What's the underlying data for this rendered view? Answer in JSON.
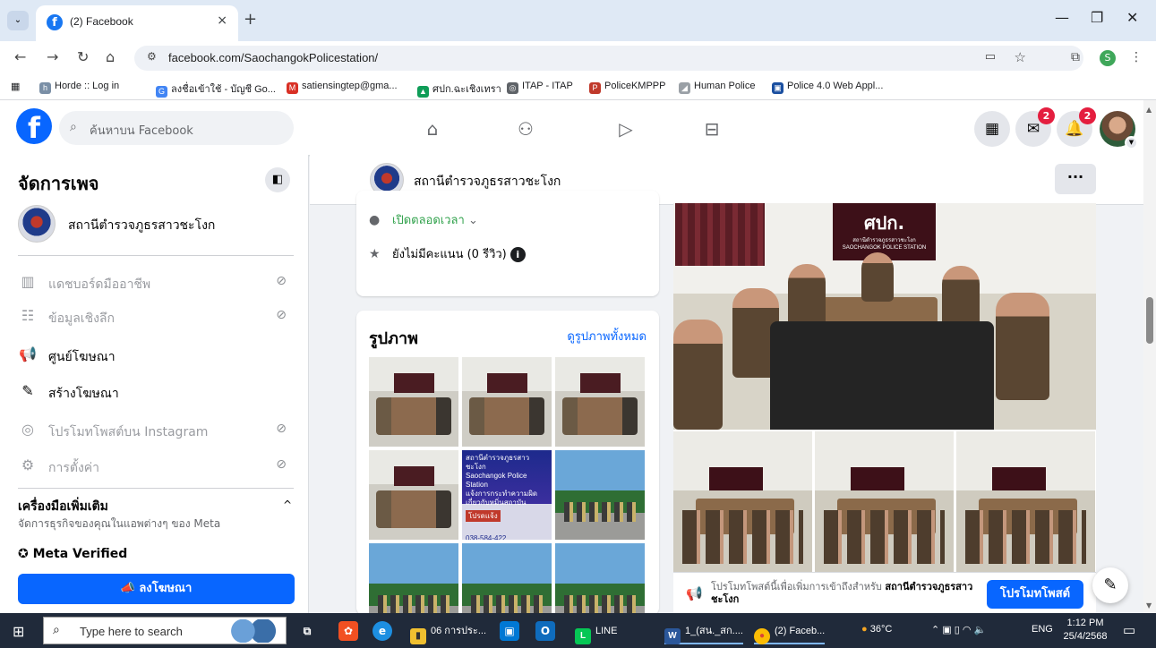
{
  "browser": {
    "tab_title": "(2) Facebook",
    "tab_close": "×",
    "new_tab": "+",
    "url": "facebook.com/SaochangokPolicestation/",
    "bookmarks": [
      "Horde :: Log in",
      "ลงชื่อเข้าใช้ - บัญชี Go...",
      "satiensingtep@gma...",
      "ศปก.ฉะเชิงเทรา",
      "ITAP - ITAP",
      "PoliceKMPPP",
      "Human Police",
      "Police 4.0 Web Appl..."
    ],
    "profile_letter": "S"
  },
  "fb": {
    "search_placeholder": "ค้นหาบน Facebook",
    "messenger_badge": "2",
    "notifications_badge": "2"
  },
  "sidebar": {
    "title": "จัดการเพจ",
    "page_name": "สถานีตำรวจภูธรสาวชะโงก",
    "items": [
      {
        "label": "แดชบอร์ดมืออาชีพ",
        "icon": "chart-icon",
        "disabled": true
      },
      {
        "label": "ข้อมูลเชิงลึก",
        "icon": "insights-icon",
        "disabled": true
      },
      {
        "label": "ศูนย์โฆษณา",
        "icon": "megaphone-icon",
        "disabled": false
      },
      {
        "label": "สร้างโฆษณา",
        "icon": "pencil-icon",
        "disabled": false
      },
      {
        "label": "โปรโมทโพสต์บน Instagram",
        "icon": "instagram-icon",
        "disabled": true
      },
      {
        "label": "การตั้งค่า",
        "icon": "gear-icon",
        "disabled": true
      }
    ],
    "more_tools_title": "เครื่องมือเพิ่มเติม",
    "more_tools_sub": "จัดการธุรกิจของคุณในแอพต่างๆ ของ Meta",
    "meta_verified": "Meta Verified",
    "ad_button": "ลงโฆษณา"
  },
  "page": {
    "name": "สถานีตำรวจภูธรสาวชะโงก",
    "more": "···",
    "hours": "เปิดตลอดเวลา",
    "rating": "ยังไม่มีคะแนน (0 รีวิว)"
  },
  "photos": {
    "title": "รูปภาพ",
    "see_all": "ดูรูปภาพทั้งหมด",
    "poster_lines": [
      "สถานีตำรวจภูธรสาวชะโงก",
      "Saochangok Police Station",
      "แจ้งการกระทำความผิด",
      "เกี่ยวกับหมิ่นสถาบัน",
      "โปรดแจ้ง"
    ],
    "poster_phone": "038-584-422"
  },
  "post": {
    "sign_text": "ศปก.",
    "sign_sub1": "สถานีตำรวจภูธรสาวชะโงก",
    "sign_sub2": "SAOCHANGOK POLICE STATION",
    "promo_text": "โปรโมทโพสต์นี้เพื่อเพิ่มการเข้าถึงสำหรับ",
    "promo_page": "สถานีตำรวจภูธรสาวชะโงก",
    "promo_button": "โปรโมทโพสต์"
  },
  "taskbar": {
    "search_placeholder": "Type here to search",
    "apps": [
      "06 การประ...",
      "LINE",
      "1_(สน._สก....",
      "(2) Faceb..."
    ],
    "temperature": "36°C",
    "language": "ENG",
    "time": "1:12 PM",
    "date": "25/4/2568"
  }
}
